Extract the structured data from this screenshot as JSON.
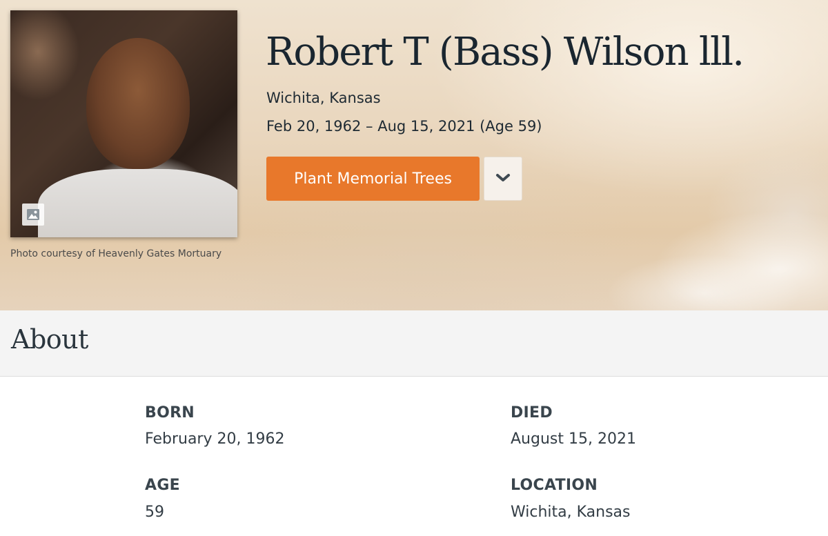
{
  "hero": {
    "name": "Robert T (Bass) Wilson lll.",
    "location": "Wichita, Kansas",
    "dates": "Feb 20, 1962 – Aug 15, 2021 (Age 59)",
    "photo_caption": "Photo courtesy of Heavenly Gates Mortuary",
    "photo_icon": "image-icon",
    "plant_button_label": "Plant Memorial Trees",
    "dropdown_icon": "chevron-down-icon",
    "accent_color": "#e8782b"
  },
  "about": {
    "title": "About",
    "facts": [
      {
        "label": "BORN",
        "value": "February 20, 1962"
      },
      {
        "label": "DIED",
        "value": "August 15, 2021"
      },
      {
        "label": "AGE",
        "value": "59"
      },
      {
        "label": "LOCATION",
        "value": "Wichita, Kansas"
      }
    ]
  }
}
